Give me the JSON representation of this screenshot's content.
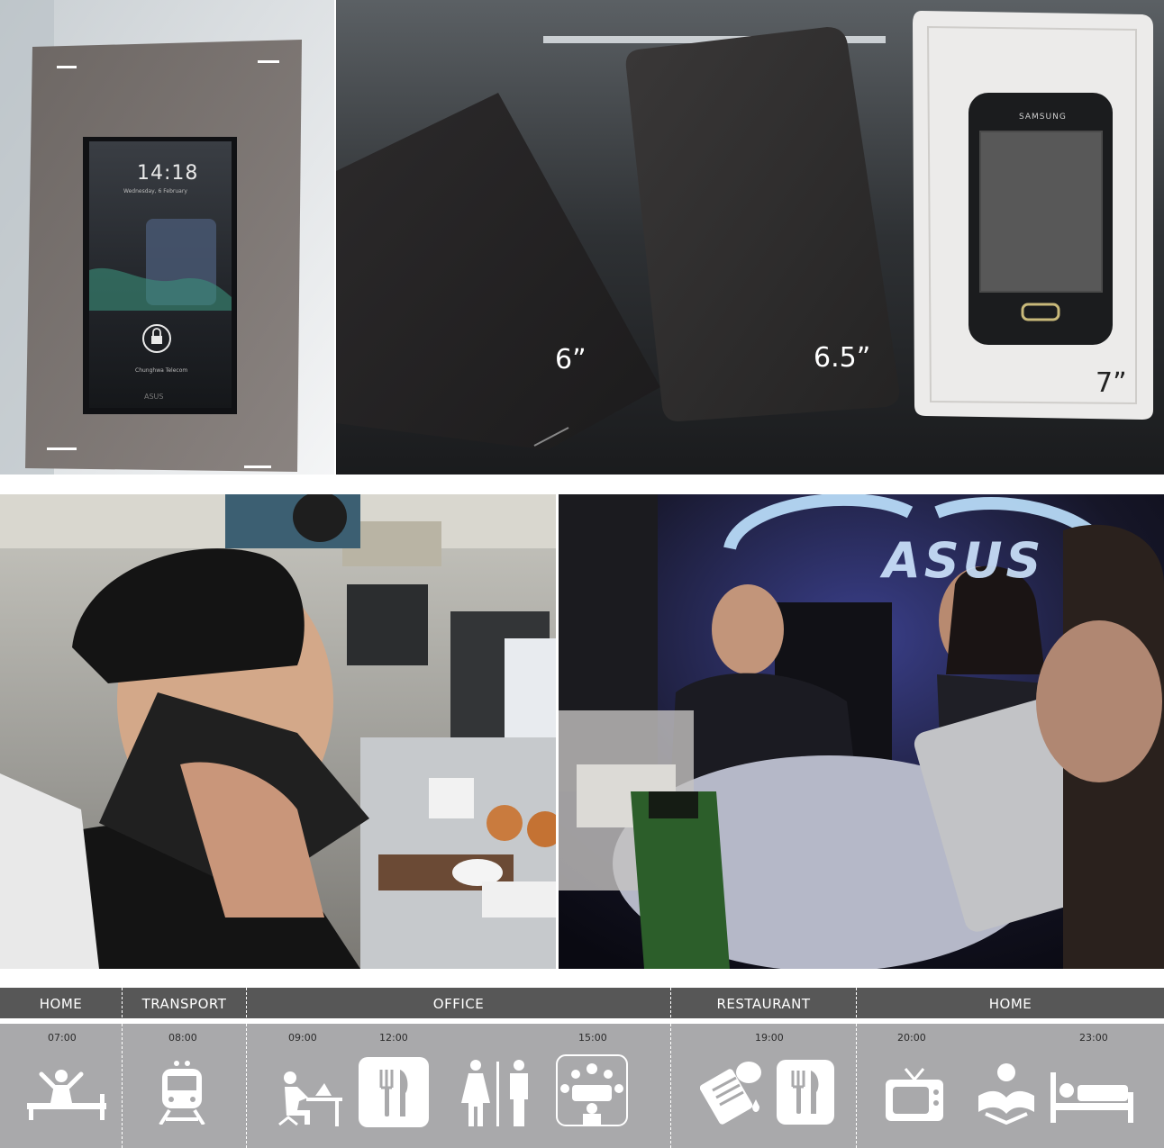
{
  "top_left_photo": {
    "lock_time": "14:18",
    "lock_date": "Wednesday, 6 February",
    "carrier": "Chunghwa Telecom",
    "brand": "ASUS"
  },
  "top_right_photo": {
    "size_labels": [
      "6”",
      "6.5”",
      "7”"
    ],
    "phone_brand": "SAMSUNG"
  },
  "restaurant_photo": {
    "backdrop_brand": "ASUS"
  },
  "timeline": {
    "sections": [
      {
        "label": "HOME"
      },
      {
        "label": "TRANSPORT"
      },
      {
        "label": "OFFICE"
      },
      {
        "label": "RESTAURANT"
      },
      {
        "label": "HOME"
      }
    ],
    "times": [
      "07:00",
      "08:00",
      "09:00",
      "12:00",
      "15:00",
      "19:00",
      "20:00",
      "23:00"
    ],
    "icons": [
      "wake-up-bed-icon",
      "train-icon",
      "person-at-desk-icon",
      "fork-knife-icon",
      "restroom-icon",
      "meeting-icon",
      "restaurant-menu-icon",
      "fork-knife-icon",
      "tv-icon",
      "reading-icon",
      "bed-sleep-icon"
    ],
    "colors": {
      "header": "#575757",
      "body": "#a9a9ab",
      "icon": "#ffffff"
    }
  }
}
